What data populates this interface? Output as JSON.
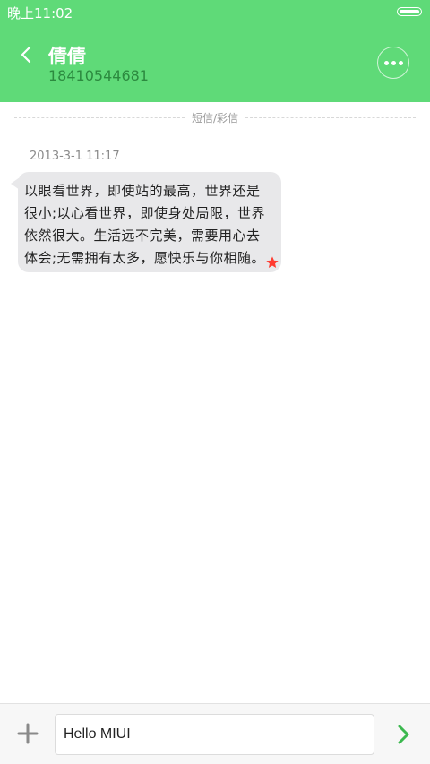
{
  "status_bar": {
    "time": "晚上11:02"
  },
  "header": {
    "contact_name": "倩倩",
    "contact_number": "18410544681"
  },
  "thread": {
    "divider_label": "短信/彩信",
    "messages": [
      {
        "timestamp": "2013-3-1 11:17",
        "text": "以眼看世界，即使站的最高，世界还是很小;以心看世界，即使身处局限，世界依然很大。生活远不完美，需要用心去体会;无需拥有太多，愿快乐与你相随。",
        "starred": true
      }
    ]
  },
  "composer": {
    "input_value": "Hello MIUI"
  },
  "colors": {
    "header_bg": "#5fda78",
    "number_text": "#2c8a3f",
    "send_accent": "#3cb84f",
    "star": "#ff3b30"
  },
  "icons": {
    "back": "back-chevron-icon",
    "more": "more-dots-icon",
    "star": "star-icon",
    "add": "plus-icon",
    "send": "send-chevron-icon"
  }
}
